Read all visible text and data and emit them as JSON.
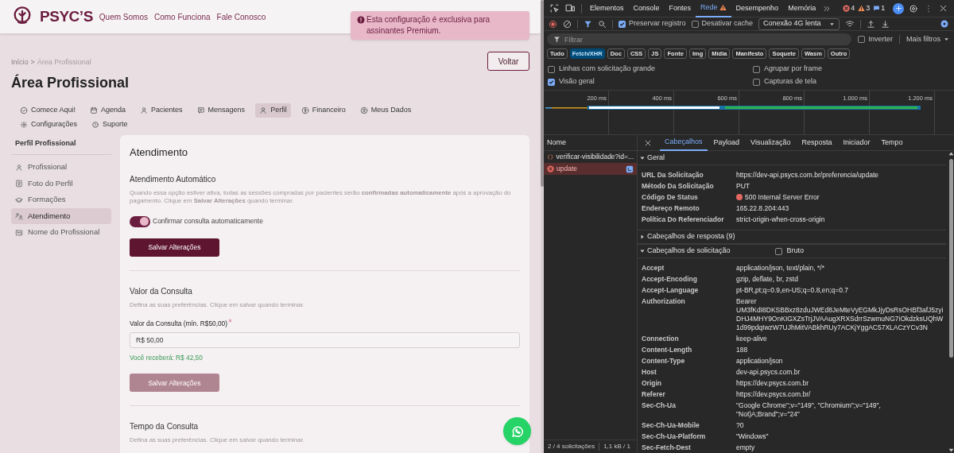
{
  "site": {
    "logo": "PSYC’S",
    "nav": [
      "Quem Somos",
      "Como Funciona",
      "Fale Conosco"
    ]
  },
  "toast": {
    "text": "Esta configuração é exclusiva para assinantes Premium."
  },
  "breadcrumb": {
    "items": [
      "Início",
      "Área Profissional"
    ],
    "separator": ">"
  },
  "back_button": "Voltar",
  "page_title": "Área Profissional",
  "tabs": [
    {
      "label": "Comece Aqui!",
      "selected": false
    },
    {
      "label": "Agenda",
      "selected": false
    },
    {
      "label": "Pacientes",
      "selected": false
    },
    {
      "label": "Mensagens",
      "selected": false
    },
    {
      "label": "Perfil",
      "selected": true
    },
    {
      "label": "Financeiro",
      "selected": false
    },
    {
      "label": "Meus Dados",
      "selected": false
    },
    {
      "label": "Configurações",
      "selected": false
    },
    {
      "label": "Suporte",
      "selected": false
    }
  ],
  "sidebar": {
    "title": "Perfil Profissional",
    "items": [
      {
        "label": "Profissional",
        "selected": false
      },
      {
        "label": "Foto do Perfil",
        "selected": false
      },
      {
        "label": "Formações",
        "selected": false
      },
      {
        "label": "Atendimento",
        "selected": true
      },
      {
        "label": "Nome do Profissional",
        "selected": false
      }
    ]
  },
  "card": {
    "title": "Atendimento",
    "sections": [
      {
        "title": "Atendimento Automático",
        "description": "Quando essa opção estiver ativa, todas as sessões compradas por pacientes serão **confirmadas automaticamente** após a aprovação do pagamento. Clique em **Salvar Alterações** quando terminar.",
        "toggle": {
          "label": "Confirmar consulta automaticamente",
          "on": true
        },
        "button": {
          "label": "Salvar Alterações",
          "disabled": false
        }
      },
      {
        "title": "Valor da Consulta",
        "description": "Defina as suas preferências. Clique em salvar quando terminar.",
        "field": {
          "label": "Valor da Consulta (mín. R$50,00)",
          "required": true,
          "value": "R$ 50,00"
        },
        "hint": "Você receberá: R$ 42,50",
        "button": {
          "label": "Salvar Alterações",
          "disabled": true
        }
      },
      {
        "title": "Tempo da Consulta",
        "description": "Defina as suas preferências. Clique em salvar quando terminar."
      }
    ]
  },
  "devtools": {
    "panel_tabs": [
      {
        "label": "Elementos",
        "selected": false,
        "warning": false
      },
      {
        "label": "Console",
        "selected": false,
        "warning": false
      },
      {
        "label": "Fontes",
        "selected": false,
        "warning": false
      },
      {
        "label": "Rede",
        "selected": true,
        "warning": true
      },
      {
        "label": "Desempenho",
        "selected": false,
        "warning": false
      },
      {
        "label": "Memória",
        "selected": false,
        "warning": false
      }
    ],
    "counts": {
      "errors": "4",
      "warnings": "3",
      "messages": "1"
    },
    "toolbar": {
      "preserve_log": {
        "label": "Preservar registro",
        "checked": true
      },
      "disable_cache": {
        "label": "Desativar cache",
        "checked": false
      },
      "throttling": "Conexão 4G lenta"
    },
    "filter": {
      "placeholder": "Filtrar",
      "invert": {
        "label": "Inverter",
        "checked": false
      },
      "more_filters": "Mais filtros"
    },
    "type_filters": [
      {
        "label": "Tudo",
        "selected": false
      },
      {
        "label": "Fetch/XHR",
        "selected": true
      },
      {
        "label": "Doc",
        "selected": false
      },
      {
        "label": "CSS",
        "selected": false
      },
      {
        "label": "JS",
        "selected": false
      },
      {
        "label": "Fonte",
        "selected": false
      },
      {
        "label": "Img",
        "selected": false
      },
      {
        "label": "Mídia",
        "selected": false
      },
      {
        "label": "Manifesto",
        "selected": false
      },
      {
        "label": "Soquete",
        "selected": false
      },
      {
        "label": "Wasm",
        "selected": false
      },
      {
        "label": "Outro",
        "selected": false
      }
    ],
    "options": [
      {
        "label": "Linhas com solicitação grande",
        "checked": false
      },
      {
        "label": "Agrupar por frame",
        "checked": false
      },
      {
        "label": "Visão geral",
        "checked": true
      },
      {
        "label": "Capturas de tela",
        "checked": false
      }
    ],
    "timeline": {
      "ticks": [
        "200 ms",
        "400 ms",
        "600 ms",
        "800 ms",
        "1.000 ms",
        "1.200 ms"
      ]
    },
    "requests": {
      "header": "Nome",
      "rows": [
        {
          "name": "verificar-visibilidade?id=...",
          "kind": "fetch",
          "selected": false
        },
        {
          "name": "update",
          "kind": "error",
          "selected": true
        }
      ]
    },
    "status_bar": [
      "2 / 4 solicitações",
      "1,1 kB / 1"
    ],
    "details": {
      "tabs": [
        {
          "label": "Cabeçalhos",
          "selected": true
        },
        {
          "label": "Payload",
          "selected": false
        },
        {
          "label": "Visualização",
          "selected": false
        },
        {
          "label": "Resposta",
          "selected": false
        },
        {
          "label": "Iniciador",
          "selected": false
        },
        {
          "label": "Tempo",
          "selected": false
        }
      ],
      "sections": [
        {
          "title": "Geral",
          "expanded": true,
          "rows": [
            {
              "name": "URL Da Solicitação",
              "value": "https://dev-api.psycs.com.br/preferencia/update",
              "kind": "text"
            },
            {
              "name": "Método Da Solicitação",
              "value": "PUT",
              "kind": "text"
            },
            {
              "name": "Código De Status",
              "value": "500 Internal Server Error",
              "kind": "status"
            },
            {
              "name": "Endereço Remoto",
              "value": "165.22.8.204:443",
              "kind": "text"
            },
            {
              "name": "Política Do Referenciador",
              "value": "strict-origin-when-cross-origin",
              "kind": "text"
            }
          ]
        },
        {
          "title": "Cabeçalhos de resposta (9)",
          "expanded": false
        },
        {
          "title": "Cabeçalhos de solicitação",
          "expanded": true,
          "raw": {
            "label": "Bruto",
            "checked": false
          },
          "rows": [
            {
              "name": "Accept",
              "value": "application/json, text/plain, */*"
            },
            {
              "name": "Accept-Encoding",
              "value": "gzip, deflate, br, zstd"
            },
            {
              "name": "Accept-Language",
              "value": "pt-BR,pt;q=0.9,en-US;q=0.8,en;q=0.7"
            },
            {
              "name": "Authorization",
              "value": "Bearer UM3fKdI8DKSBBxz8zduJWEd8JeMteVyEGMkJjyDsRsOHBf3afJ5zyiDHJ4MHY9OnKIGXZsTrjJVAAugXRXSdrrSzwmuNG7iOkdzksUQhW1d99pdqIwzW7UJhMitVABkhRUy7ACKjYggAC57XLACzYCv3N"
            },
            {
              "name": "Connection",
              "value": "keep-alive"
            },
            {
              "name": "Content-Length",
              "value": "188"
            },
            {
              "name": "Content-Type",
              "value": "application/json"
            },
            {
              "name": "Host",
              "value": "dev-api.psycs.com.br"
            },
            {
              "name": "Origin",
              "value": "https://dev.psycs.com.br"
            },
            {
              "name": "Referer",
              "value": "https://dev.psycs.com.br/"
            },
            {
              "name": "Sec-Ch-Ua",
              "value": "\"Google Chrome\";v=\"149\", \"Chromium\";v=\"149\", \"Not)A;Brand\";v=\"24\""
            },
            {
              "name": "Sec-Ch-Ua-Mobile",
              "value": "?0"
            },
            {
              "name": "Sec-Ch-Ua-Platform",
              "value": "\"Windows\""
            },
            {
              "name": "Sec-Fetch-Dest",
              "value": "empty"
            }
          ]
        }
      ]
    }
  }
}
